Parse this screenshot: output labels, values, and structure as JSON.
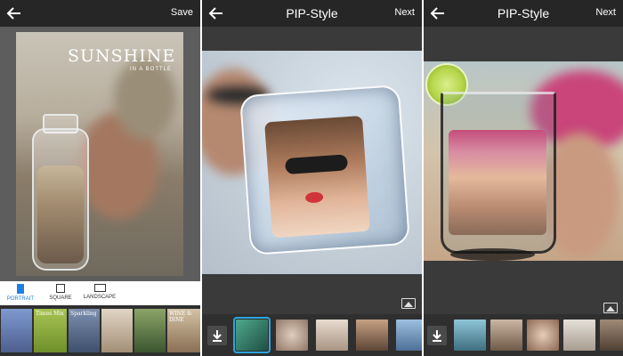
{
  "panel1": {
    "save_label": "Save",
    "poster_title": "SUNSHINE",
    "poster_subtitle": "IN A BOTTLE",
    "ratios": [
      {
        "label": "PORTRAIT",
        "active": true
      },
      {
        "label": "SQUARE",
        "active": false
      },
      {
        "label": "LANDSCAPE",
        "active": false
      }
    ],
    "thumbnails": [
      {
        "label": "",
        "color": "#5b79b0"
      },
      {
        "label": "Times Mix",
        "color": "#7a9e3a"
      },
      {
        "label": "Sparkling",
        "color": "#5a6b8c"
      },
      {
        "label": "",
        "color": "#b5a28a"
      },
      {
        "label": "",
        "color": "#4f6b3c"
      },
      {
        "label": "WINE & DINE",
        "color": "#8a6f55"
      }
    ]
  },
  "panel2": {
    "title": "PIP-Style",
    "next_label": "Next",
    "thumbnails": [
      {
        "color": "#2f7a6a",
        "selected": true
      },
      {
        "color": "#b49a8a",
        "selected": false
      },
      {
        "color": "#c7b6a6",
        "selected": false
      },
      {
        "color": "#8a6a52",
        "selected": false
      },
      {
        "color": "#6f8fb0",
        "selected": false
      }
    ]
  },
  "panel3": {
    "title": "PIP-Style",
    "next_label": "Next",
    "thumbnails": [
      {
        "color": "#6f9fb0"
      },
      {
        "color": "#a8927e"
      },
      {
        "color": "#b48d7a"
      },
      {
        "color": "#c7c0b4"
      },
      {
        "color": "#7a6a5a"
      }
    ]
  },
  "colors": {
    "accent": "#1e7fe0",
    "selection": "#29a6e0",
    "topbar": "#262626"
  }
}
